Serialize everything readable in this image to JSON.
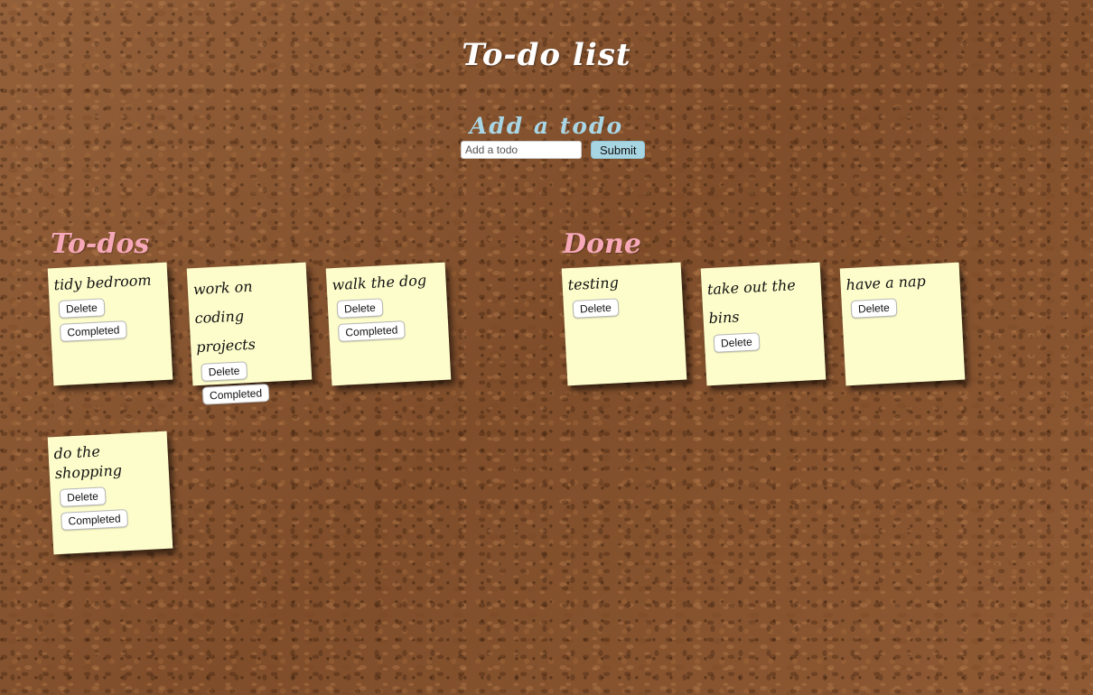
{
  "app": {
    "title": "To-do list"
  },
  "add_section": {
    "heading": "Add a todo",
    "input_placeholder": "Add a todo",
    "input_value": "",
    "submit_label": "Submit"
  },
  "todos": {
    "heading": "To-dos",
    "items": [
      {
        "text": "tidy bedroom",
        "delete_label": "Delete",
        "completed_label": "Completed"
      },
      {
        "text": "work on coding projects",
        "delete_label": "Delete",
        "completed_label": "Completed"
      },
      {
        "text": "walk the dog",
        "delete_label": "Delete",
        "completed_label": "Completed"
      },
      {
        "text": "do the shopping",
        "delete_label": "Delete",
        "completed_label": "Completed"
      }
    ]
  },
  "done": {
    "heading": "Done",
    "items": [
      {
        "text": "testing",
        "delete_label": "Delete"
      },
      {
        "text": "take out the bins",
        "delete_label": "Delete"
      },
      {
        "text": "have a nap",
        "delete_label": "Delete"
      }
    ]
  },
  "colors": {
    "note_background": "#fdfdcb",
    "section_heading": "#f6a8b8",
    "add_heading": "#a9d6e5",
    "submit_button": "#a8d5e2",
    "board": "#8a5530"
  }
}
